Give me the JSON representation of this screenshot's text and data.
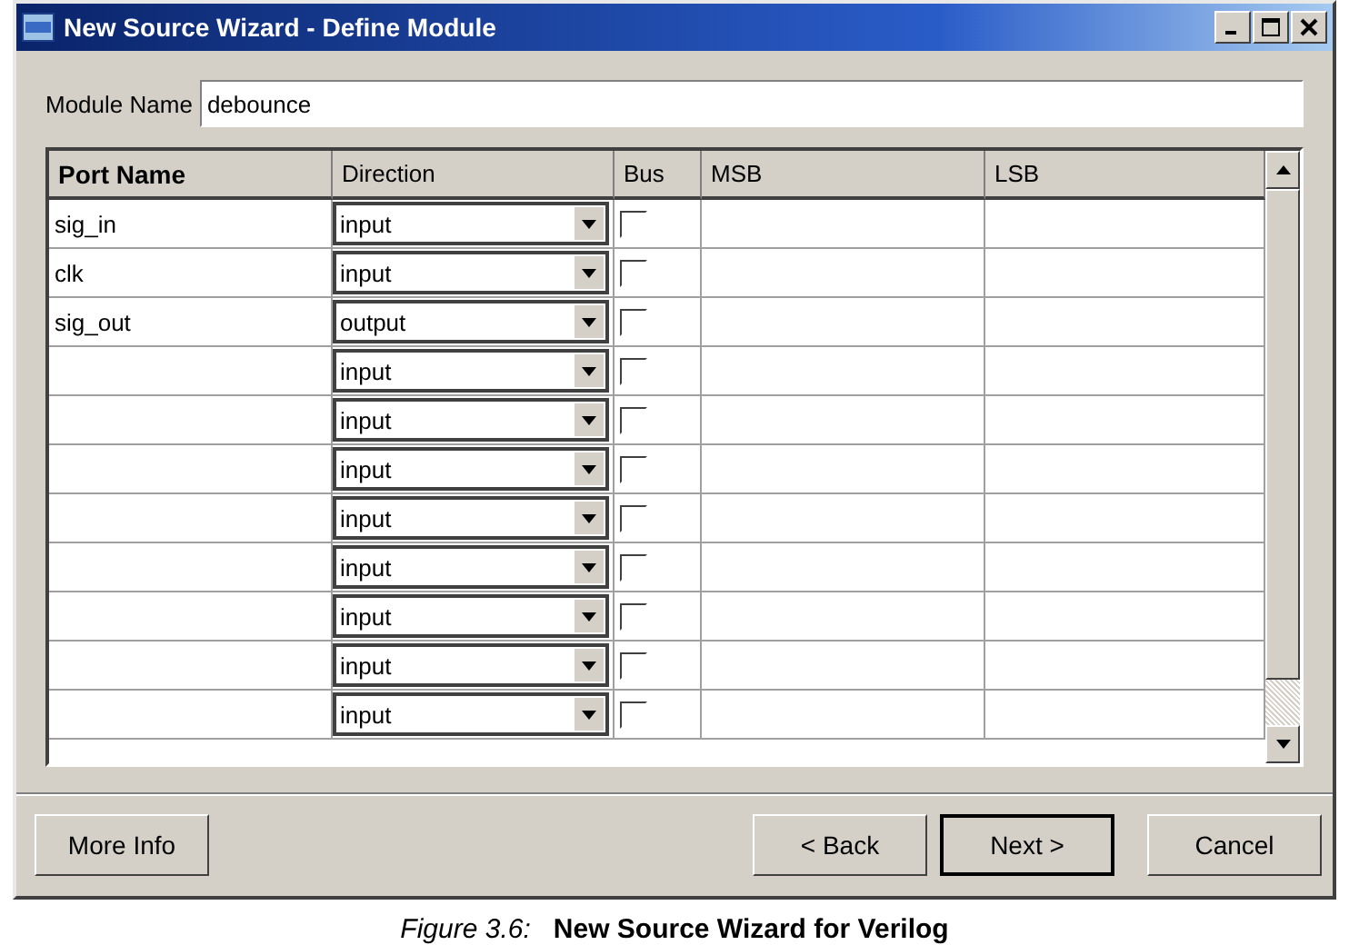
{
  "window": {
    "title": "New Source Wizard - Define Module"
  },
  "module_name": {
    "label": "Module Name",
    "value": "debounce"
  },
  "table": {
    "columns": [
      "Port Name",
      "Direction",
      "Bus",
      "MSB",
      "LSB"
    ],
    "rows": [
      {
        "port_name": "sig_in",
        "direction": "input",
        "bus": false
      },
      {
        "port_name": "clk",
        "direction": "input",
        "bus": false
      },
      {
        "port_name": "sig_out",
        "direction": "output",
        "bus": false
      },
      {
        "port_name": "",
        "direction": "input",
        "bus": false
      },
      {
        "port_name": "",
        "direction": "input",
        "bus": false
      },
      {
        "port_name": "",
        "direction": "input",
        "bus": false
      },
      {
        "port_name": "",
        "direction": "input",
        "bus": false
      },
      {
        "port_name": "",
        "direction": "input",
        "bus": false
      },
      {
        "port_name": "",
        "direction": "input",
        "bus": false
      },
      {
        "port_name": "",
        "direction": "input",
        "bus": false
      },
      {
        "port_name": "",
        "direction": "input",
        "bus": false
      }
    ]
  },
  "buttons": {
    "left": [
      "More Info"
    ],
    "right": [
      {
        "label": "< Back",
        "default": false
      },
      {
        "label": "Next >",
        "default": true
      },
      {
        "label": "Cancel",
        "default": false
      }
    ]
  },
  "caption": {
    "label": "Figure 3.6:",
    "title": "New Source Wizard for Verilog"
  }
}
